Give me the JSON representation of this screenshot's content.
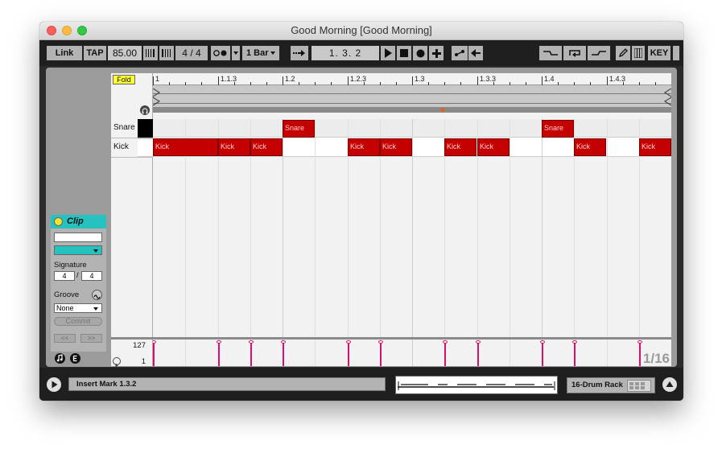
{
  "window": {
    "title": "Good Morning  [Good Morning]"
  },
  "toolbar": {
    "link_label": "Link",
    "tap_label": "TAP",
    "tempo": "85.00",
    "signature_num": "4",
    "signature_slash": "/",
    "signature_den": "4",
    "quantize": "1 Bar",
    "position": "1.   3.   2",
    "key_label": "KEY"
  },
  "editor": {
    "fold_label": "Fold",
    "ruler_ticks": [
      "1",
      "1.1.3",
      "1.2",
      "1.2.3",
      "1.3",
      "1.3.3",
      "1.4",
      "1.4.3"
    ],
    "lanes": [
      {
        "label": "Snare",
        "notes": [
          {
            "label": "Snare",
            "start": 0.25,
            "length": 0.0625
          },
          {
            "label": "Snare",
            "start": 0.75,
            "length": 0.0625
          }
        ]
      },
      {
        "label": "Kick",
        "notes": [
          {
            "label": "Kick",
            "start": 0.0,
            "length": 0.125
          },
          {
            "label": "Kick",
            "start": 0.125,
            "length": 0.0625
          },
          {
            "label": "Kick",
            "start": 0.1875,
            "length": 0.0625
          },
          {
            "label": "Kick",
            "start": 0.375,
            "length": 0.0625
          },
          {
            "label": "Kick",
            "start": 0.4375,
            "length": 0.0625
          },
          {
            "label": "Kick",
            "start": 0.5625,
            "length": 0.0625
          },
          {
            "label": "Kick",
            "start": 0.625,
            "length": 0.0625
          },
          {
            "label": "Kick",
            "start": 0.8125,
            "length": 0.0625
          },
          {
            "label": "Kick",
            "start": 0.9375,
            "length": 0.0625
          }
        ]
      }
    ],
    "velocity_max": "127",
    "velocity_min": "1",
    "grid_label": "1/16"
  },
  "clip_panel": {
    "title": "Clip",
    "signature_label": "Signature",
    "signature_num": "4",
    "signature_slash": "/",
    "signature_den": "4",
    "groove_label": "Groove",
    "groove_value": "None",
    "commit_label": "Commit",
    "prev_label": "<<",
    "next_label": ">>",
    "accent_color": "#26c2c0"
  },
  "status": {
    "message": "Insert Mark 1.3.2",
    "device": "16-Drum Rack"
  },
  "colors": {
    "note": "#c40000",
    "velocity": "#d60f6a",
    "fold": "#ffff33"
  }
}
